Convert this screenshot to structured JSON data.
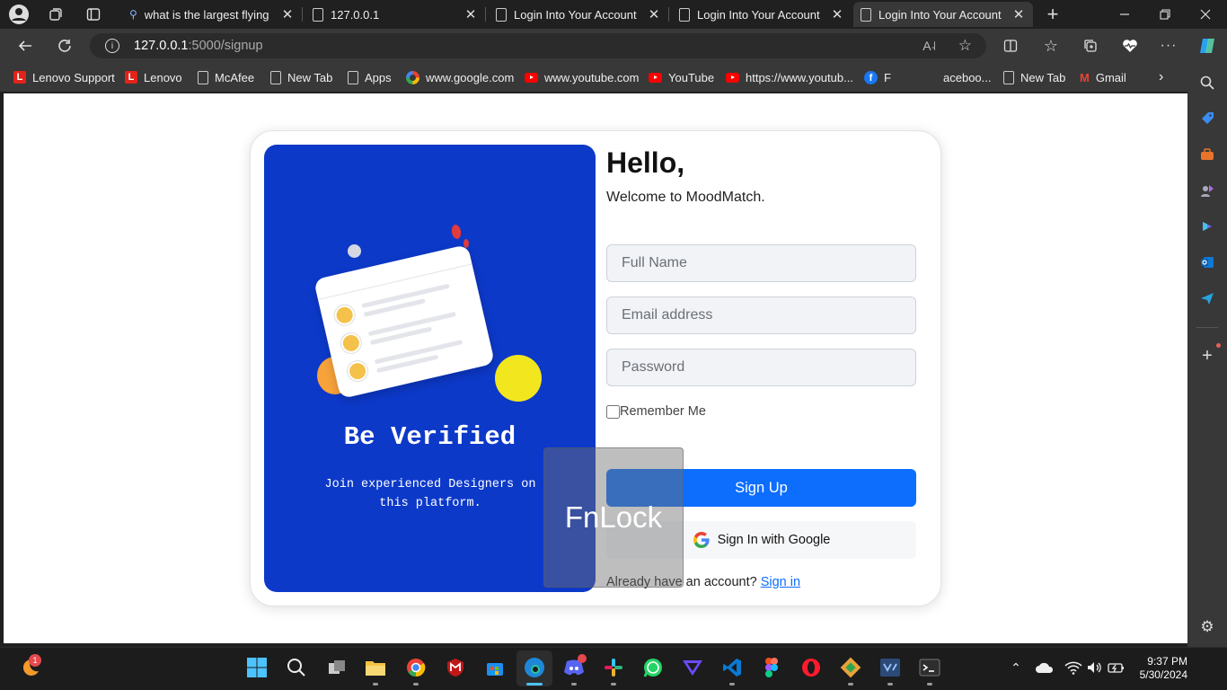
{
  "browser": {
    "tabs": [
      {
        "title": "what is the largest flying b",
        "close": "✕"
      },
      {
        "title": "127.0.0.1",
        "close": "✕"
      },
      {
        "title": "Login Into Your Account",
        "close": "✕"
      },
      {
        "title": "Login Into Your Account",
        "close": "✕"
      },
      {
        "title": "Login Into Your Account",
        "close": "✕"
      }
    ],
    "new_tab": "+",
    "address": {
      "host": "127.0.0.1",
      "path": ":5000/signup"
    },
    "bookmarks": [
      "Lenovo Support",
      "Lenovo",
      "McAfee",
      "New Tab",
      "Apps",
      "www.google.com",
      "www.youtube.com",
      "YouTube",
      "https://www.youtub...",
      "F",
      "aceboo...",
      "New Tab",
      "Gmail"
    ]
  },
  "left_panel": {
    "title": "Be Verified",
    "subtitle": "Join experienced Designers on this platform."
  },
  "form": {
    "greeting": "Hello,",
    "welcome": "Welcome to MoodMatch.",
    "full_name_placeholder": "Full Name",
    "email_placeholder": "Email address",
    "password_placeholder": "Password",
    "remember_label": "Remember Me",
    "signup_label": "Sign Up",
    "google_label": "Sign In with Google",
    "already_text": "Already have an account?",
    "signin_link": "Sign in"
  },
  "overlay": {
    "text": "FnLock"
  },
  "taskbar": {
    "badge": "1",
    "time": "9:37 PM",
    "date": "5/30/2024"
  },
  "colors": {
    "panel_blue": "#0d39c9",
    "primary": "#0d6efd",
    "accent_yellow": "#f2e61e",
    "accent_orange": "#f7a23b"
  }
}
